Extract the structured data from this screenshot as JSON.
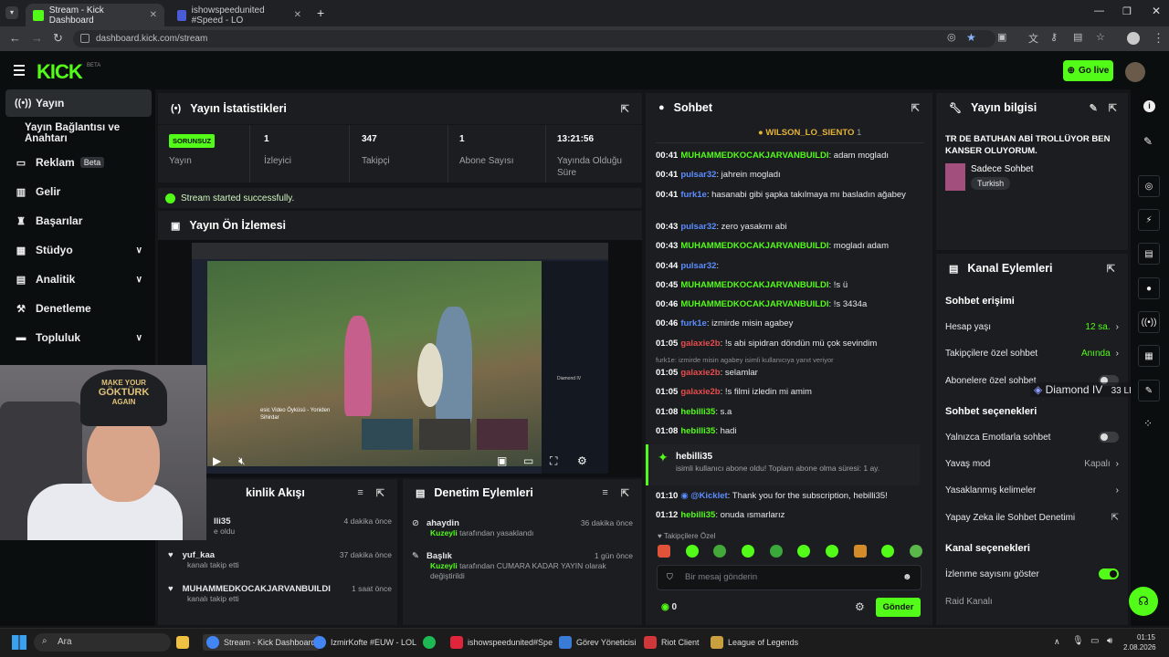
{
  "browser": {
    "tabs": [
      {
        "label": "Stream - Kick Dashboard"
      },
      {
        "label": "ishowspeedunited #Speed - LO"
      }
    ],
    "url": "dashboard.kick.com/stream"
  },
  "topnav": {
    "logo": "KICK",
    "beta": "BETA",
    "go_live": "Go live"
  },
  "sidebar": {
    "items": [
      {
        "label": "Yayın"
      },
      {
        "label": "Yayın Bağlantısı ve Anahtarı"
      },
      {
        "label": "Reklam",
        "badge": "Beta"
      },
      {
        "label": "Gelir"
      },
      {
        "label": "Başarılar"
      },
      {
        "label": "Stüdyo"
      },
      {
        "label": "Analitik"
      },
      {
        "label": "Denetleme"
      },
      {
        "label": "Topluluk"
      }
    ]
  },
  "stats": {
    "title": "Yayın İstatistikleri",
    "offline_badge": "SORUNSUZ",
    "cells": [
      {
        "label": "Yayın"
      },
      {
        "value": "1",
        "label": "İzleyici"
      },
      {
        "value": "347",
        "label": "Takipçi"
      },
      {
        "value": "1",
        "label": "Abone Sayısı"
      },
      {
        "value": "13:21:56",
        "label": "Yayında Olduğu Süre"
      }
    ],
    "success": "Stream started successfully."
  },
  "preview": {
    "title": "Yayın Ön İzlemesi",
    "overlay_rank": "Diamond IV",
    "overlay_lp": "33 LP",
    "card_text": "esic Video Öyküsü - Yoniden Sihirdar"
  },
  "activity": {
    "title": "kinlik Akışı",
    "rows": [
      {
        "name": "lli35",
        "sub": "e oldu",
        "time": "4 dakika önce"
      },
      {
        "name": "yuf_kaa",
        "sub": "kanalı takip etti",
        "time": "37 dakika önce"
      },
      {
        "name": "MUHAMMEDKOCAKJARVANBUILDI",
        "sub": "kanalı takip etti",
        "time": "1 saat önce"
      }
    ]
  },
  "moderation": {
    "title": "Denetim Eylemleri",
    "rows": [
      {
        "name": "ahaydin",
        "by": "Kuzeyli",
        "sub": "tarafından yasaklandı",
        "time": "36 dakika önce"
      },
      {
        "name": "Başlık",
        "by": "Kuzeyli",
        "sub": "tarafından CUMARA KADAR YAYIN olarak değiştirildi",
        "time": "1 gün önce"
      }
    ]
  },
  "chat": {
    "title": "Sohbet",
    "pinned_user": "WILSON_LO_SIENTO",
    "pinned_count": "1",
    "messages": [
      {
        "t": "00:41",
        "u": "MUHAMMEDKOCAKJARVANBUILDI",
        "c": "g",
        "m": ": adam mogladı"
      },
      {
        "t": "00:41",
        "u": "pulsar32",
        "c": "b",
        "m": ": jahrein mogladı"
      },
      {
        "t": "00:41",
        "u": "furk1e",
        "c": "b",
        "m": ": hasanabi gibi şapka takılmaya mı basladın ağabey"
      },
      {
        "t": "00:43",
        "u": "pulsar32",
        "c": "b",
        "m": ": zero yasakmı abi"
      },
      {
        "t": "00:43",
        "u": "MUHAMMEDKOCAKJARVANBUILDI",
        "c": "g",
        "m": ": mogladı adam"
      },
      {
        "t": "00:44",
        "u": "pulsar32",
        "c": "b",
        "m": ":"
      },
      {
        "t": "00:45",
        "u": "MUHAMMEDKOCAKJARVANBUILDI",
        "c": "g",
        "m": ": !s ü"
      },
      {
        "t": "00:46",
        "u": "MUHAMMEDKOCAKJARVANBUILDI",
        "c": "g",
        "m": ": !s 3434a"
      },
      {
        "t": "00:46",
        "u": "furk1e",
        "c": "b",
        "m": ": izmirde misin agabey"
      },
      {
        "t": "01:05",
        "u": "galaxie2b",
        "c": "r",
        "m": ": !s abi sipidran döndün mü çok sevindim"
      },
      {
        "t": "01:05",
        "u": "galaxie2b",
        "c": "r",
        "m": ": selamlar"
      },
      {
        "t": "01:05",
        "u": "galaxie2b",
        "c": "r",
        "m": ": !s filmi izledin mi amim"
      },
      {
        "t": "01:08",
        "u": "hebilli35",
        "c": "g",
        "m": ": s.a"
      },
      {
        "t": "01:08",
        "u": "hebilli35",
        "c": "g",
        "m": ": hadi"
      }
    ],
    "reply_note": "furk1e: izmirde misin agabey isimli kullanıcıya yanıt veriyor",
    "sub_user": "hebilli35",
    "sub_text": "isimli kullanıcı abone oldu! Toplam abone olma süresi: 1 ay.",
    "bot_time": "01:10",
    "bot_user": "@Kicklet",
    "bot_msg": ": Thank you for the subscription, hebilli35!",
    "last_time": "01:12",
    "last_user": "hebilli35",
    "last_msg": ": onuda ısmarlarız",
    "followers_only": "Takipçilere Özel",
    "placeholder": "Bir mesaj gönderin",
    "count": "0",
    "send": "Gönder"
  },
  "info": {
    "title": "Yayın bilgisi",
    "stream_title": "TR DE BATUHAN ABİ TROLLÜYOR BEN KANSER OLUYORUM.",
    "category": "Sadece Sohbet",
    "tag": "Turkish"
  },
  "actions": {
    "title": "Kanal Eylemleri",
    "chat_access": "Sohbet erişimi",
    "rows1": [
      {
        "label": "Hesap yaşı",
        "val": "12 sa."
      },
      {
        "label": "Takipçilere özel sohbet",
        "val": "Anında"
      },
      {
        "label": "Abonelere özel sohbet"
      }
    ],
    "chat_options": "Sohbet seçenekleri",
    "rows2": [
      {
        "label": "Yalnızca Emotlarla sohbet"
      },
      {
        "label": "Yavaş mod",
        "val": "Kapalı"
      },
      {
        "label": "Yasaklanmış kelimeler"
      },
      {
        "label": "Yapay Zeka ile Sohbet Denetimi"
      }
    ],
    "channel_options": "Kanal seçenekleri",
    "rows3": [
      {
        "label": "İzlenme sayısını göster"
      },
      {
        "label": "Raid Kanalı"
      }
    ]
  },
  "webcam": {
    "cap_line1": "MAKE YOUR",
    "cap_line2": "GÖKTÜRK",
    "cap_line3": "AGAIN"
  },
  "taskbar": {
    "search": "Ara",
    "items": [
      "Stream - Kick Dashboard",
      "IzmirKofte #EUW - LOL",
      "ishowspeedunited#Spe",
      "Görev Yöneticisi",
      "Riot Client",
      "League of Legends"
    ],
    "time": "01:15",
    "date": "2.08.2026"
  },
  "colors": {
    "accent": "#53fc18",
    "bg": "#141517",
    "panel": "#1b1d20"
  }
}
